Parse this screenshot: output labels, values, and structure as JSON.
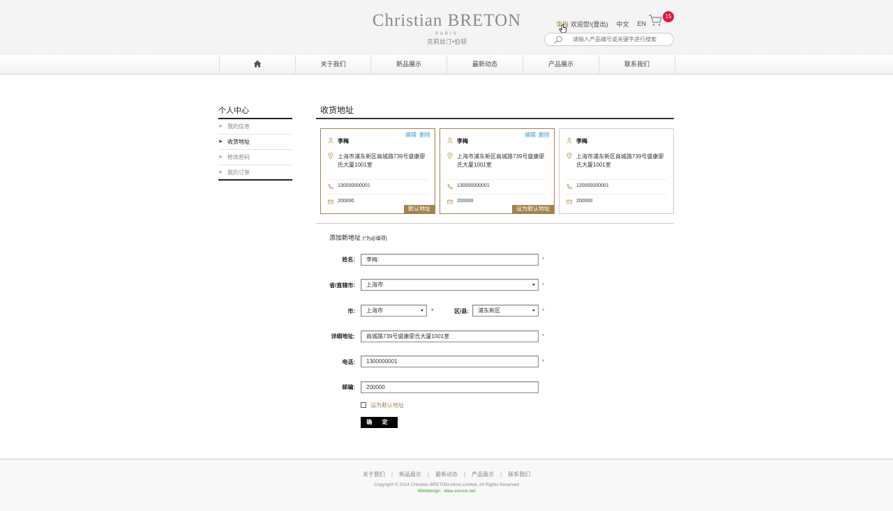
{
  "header": {
    "logo_main": "Christian BRETON",
    "logo_sub": "PARIS",
    "logo_cn": "克莉丝汀•伯顿",
    "user_name": "李梅",
    "welcome": "欢迎您!(登出)",
    "lang_cn": "中文",
    "lang_en": "EN",
    "cart_count": "15",
    "search_placeholder": "请输入产品编号或关键字进行搜索"
  },
  "nav": {
    "items": [
      {
        "label": "关于我们"
      },
      {
        "label": "新品展示"
      },
      {
        "label": "最新动态"
      },
      {
        "label": "产品展示"
      },
      {
        "label": "联系我们"
      }
    ]
  },
  "sidebar": {
    "title": "个人中心",
    "items": [
      {
        "label": "我的信息"
      },
      {
        "label": "收货地址"
      },
      {
        "label": "修改密码"
      },
      {
        "label": "我的订单"
      }
    ]
  },
  "main": {
    "title": "收货地址",
    "cards": [
      {
        "name": "李梅",
        "address": "上海市浦东新区商城路739号盛康廖氏大厦1001室",
        "phone": "130000000001",
        "zip": "200000",
        "edit": "编辑",
        "delete": "删除",
        "badge": "默认地址"
      },
      {
        "name": "李梅",
        "address": "上海市浦东新区商城路739号盛康廖氏大厦1001室",
        "phone": "130000000001",
        "zip": "200000",
        "edit": "编辑",
        "delete": "删除",
        "badge": "设为默认地址"
      },
      {
        "name": "李梅",
        "address": "上海市浦东新区商城路739号盛康廖氏大厦1001室",
        "phone": "120000000001",
        "zip": "200000"
      }
    ]
  },
  "form": {
    "title": "添加新地址",
    "note": "(*为必填项)",
    "name_label": "姓名:",
    "name_value": "李梅:",
    "province_label": "省/直辖市:",
    "province_value": "上海市",
    "city_label": "市:",
    "city_value": "上海市",
    "district_label": "区/县:",
    "district_value": "浦东新区",
    "address_label": "详细地址:",
    "address_value": "商城路739号盛康廖氏大厦1001室",
    "phone_label": "电话:",
    "phone_value": "1300000001",
    "zip_label": "邮编:",
    "zip_value": "200000",
    "required_mark": "*",
    "default_label": "设为默认地址",
    "submit": "确 定"
  },
  "footer": {
    "links": [
      "关于我们",
      "新品展示",
      "最新动态",
      "产品展示",
      "联系我们"
    ],
    "separator": "|",
    "copyright": "Copyright © 2014 Christian BRETON-china Limited, All Rights Reserved",
    "webdesign": "Webdesign : idea-source.net"
  },
  "colors": {
    "accent": "#a3834e",
    "link_blue": "#4a9ad6",
    "badge_red": "#e5143c",
    "footer_green": "#3a9a2a"
  }
}
